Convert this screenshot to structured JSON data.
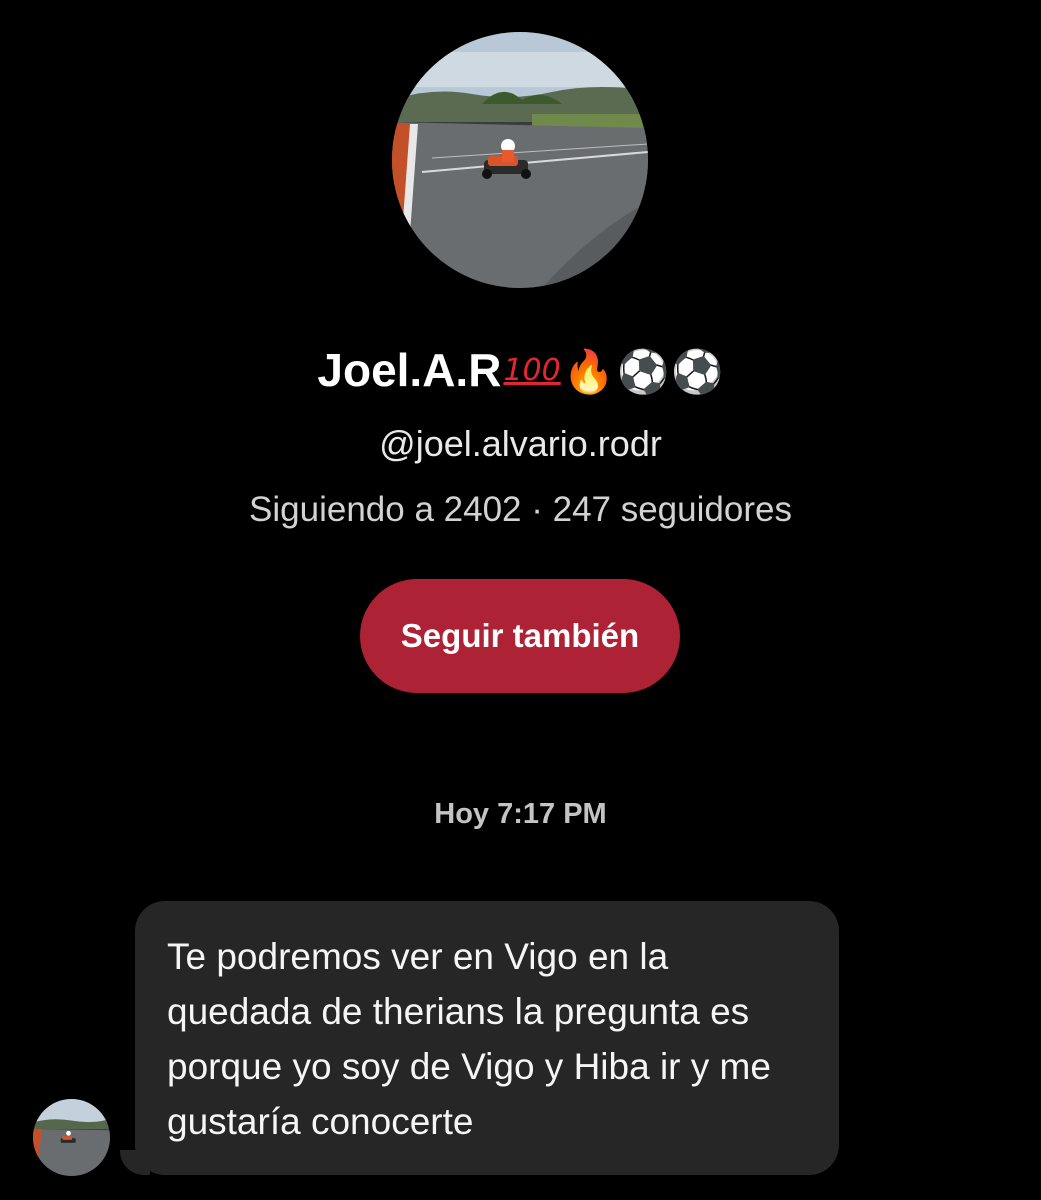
{
  "profile": {
    "display_name": "Joel.A.R",
    "name_emojis": {
      "hundred": "100",
      "fire": "🔥",
      "ball_1": "⚽",
      "ball_2": "⚽"
    },
    "username": "@joel.alvario.rodr",
    "stats": "Siguiendo a 2402 · 247 seguidores",
    "avatar_icon": "go-kart-photo-avatar"
  },
  "actions": {
    "follow_label": "Seguir también",
    "follow_color": "#ad2234"
  },
  "chat": {
    "timestamp": "Hoy 7:17 PM",
    "messages": [
      {
        "text": "Te podremos ver en Vigo en la quedada de therians la pregunta es porque yo soy de Vigo y Hiba ir y me gustaría conocerte",
        "bubble_color": "#262626"
      }
    ]
  },
  "colors": {
    "background": "#000000",
    "bubble": "#262626",
    "accent": "#ad2234"
  }
}
